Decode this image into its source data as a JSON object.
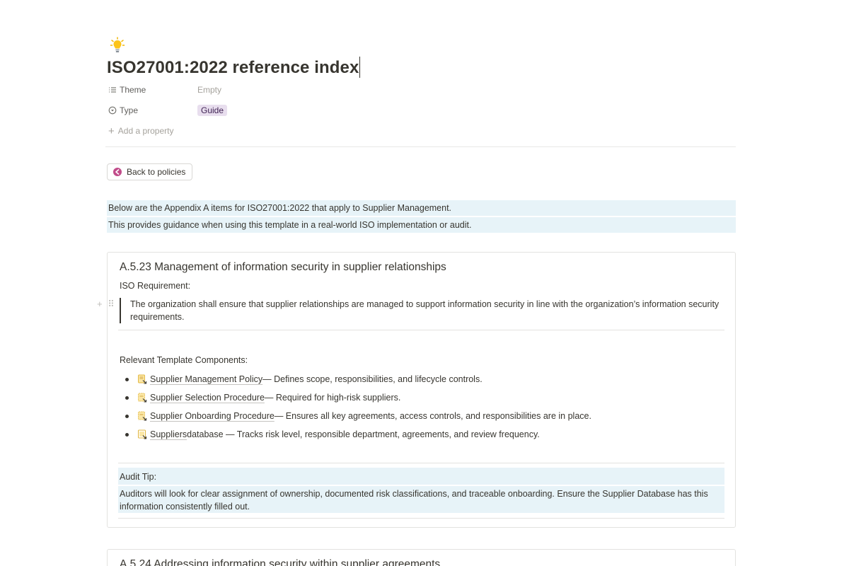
{
  "page": {
    "icon": "lightbulb-icon",
    "title": "ISO27001:2022 reference index"
  },
  "properties": {
    "theme_label": "Theme",
    "theme_value": "Empty",
    "type_label": "Type",
    "type_value": "Guide",
    "add_label": "Add a property"
  },
  "back_button": {
    "label": "Back to policies",
    "icon": "arrow-left-circle-icon",
    "color": "#c14c8a"
  },
  "intro": {
    "line1": "Below are the Appendix A items for ISO27001:2022 that apply to Supplier Management.",
    "line2": "This provides guidance when using this template in a real-world ISO implementation or audit."
  },
  "section1": {
    "heading": "A.5.23 Management of information security in supplier relationships",
    "requirement_label": "ISO Requirement:",
    "requirement_text": "The organization shall ensure that supplier relationships are managed to support information security in line with the organization’s information security requirements.",
    "components_label": "Relevant Template Components:",
    "components": [
      {
        "link": "Supplier Management Policy",
        "rest": " — Defines scope, responsibilities, and lifecycle controls."
      },
      {
        "link": "Supplier Selection Procedure",
        "rest": " — Required for high-risk suppliers."
      },
      {
        "link": "Supplier Onboarding Procedure",
        "rest": " — Ensures all key agreements, access controls, and responsibilities are in place."
      },
      {
        "link": "Suppliers",
        "rest": " database — Tracks risk level, responsible department, agreements, and review frequency."
      }
    ],
    "audit_tip_title": "Audit Tip:",
    "audit_tip_body": "Auditors will look for clear assignment of ownership, documented risk classifications, and traceable onboarding. Ensure the Supplier Database has this information consistently filled out."
  },
  "section2": {
    "heading": "A.5.24 Addressing information security within supplier agreements"
  },
  "colors": {
    "callout_bg": "#e7f3f8",
    "tag_bg": "#e8deee"
  }
}
